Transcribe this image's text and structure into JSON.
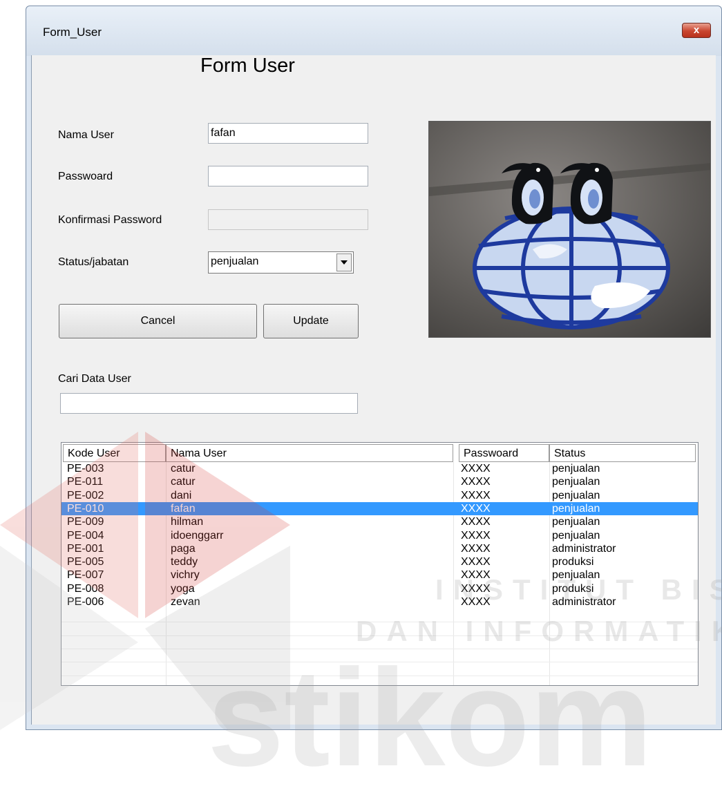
{
  "window": {
    "title": "Form_User",
    "close_label": "x"
  },
  "form": {
    "heading": "Form User",
    "nama_user_label": "Nama User",
    "nama_user_value": "fafan",
    "password_label": "Passwoard",
    "password_value": "",
    "konfirmasi_label": "Konfirmasi Password",
    "konfirmasi_value": "",
    "status_label": "Status/jabatan",
    "status_value": "penjualan",
    "cancel_label": "Cancel",
    "update_label": "Update",
    "cari_label": "Cari Data User",
    "cari_value": ""
  },
  "table": {
    "columns": [
      "Kode User",
      "Nama User",
      "Passwoard",
      "Status"
    ],
    "rows": [
      [
        "PE-003",
        "catur",
        "XXXX",
        "penjualan"
      ],
      [
        "PE-011",
        "catur",
        "XXXX",
        "penjualan"
      ],
      [
        "PE-002",
        "dani",
        "XXXX",
        "penjualan"
      ],
      [
        "PE-010",
        "fafan",
        "XXXX",
        "penjualan"
      ],
      [
        "PE-009",
        "hilman",
        "XXXX",
        "penjualan"
      ],
      [
        "PE-004",
        "idoenggarr",
        "XXXX",
        "penjualan"
      ],
      [
        "PE-001",
        "paga",
        "XXXX",
        "administrator"
      ],
      [
        "PE-005",
        "teddy",
        "XXXX",
        "produksi"
      ],
      [
        "PE-007",
        "vichry",
        "XXXX",
        "penjualan"
      ],
      [
        "PE-008",
        "yoga",
        "XXXX",
        "produksi"
      ],
      [
        "PE-006",
        "zevan",
        "XXXX",
        "administrator"
      ]
    ],
    "selected_row_index": 3
  },
  "watermark": {
    "line1": "INSTITUT BISNIS",
    "line2": "DAN INFORMATIKA",
    "brand": "stikom",
    "color_red": "#d53d35",
    "color_gray": "#9a9a9a"
  },
  "colors": {
    "selection": "#3399ff",
    "window_bg": "#f0f0f0",
    "logo_blue": "#1e3a9e"
  }
}
